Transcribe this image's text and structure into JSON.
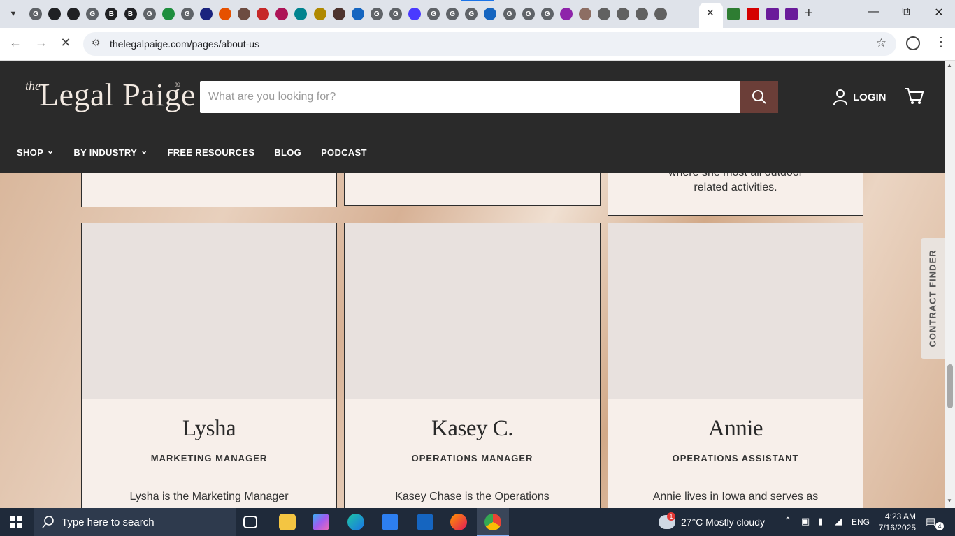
{
  "browser": {
    "url": "thelegalpaige.com/pages/about-us",
    "tab_favicon_letters": [
      "G",
      "",
      "",
      "G",
      "B",
      "B",
      "G",
      "",
      "G",
      "",
      "",
      "",
      "",
      "",
      "",
      "",
      "",
      "",
      "G",
      "G",
      "",
      "G",
      "G",
      "G",
      "",
      "G",
      "G",
      "G",
      "",
      "",
      "",
      "",
      "",
      ""
    ]
  },
  "site": {
    "logo_the": "the",
    "logo_name": "Legal Paige",
    "logo_reg": "®",
    "search_placeholder": "What are you looking for?",
    "login_label": "LOGIN",
    "nav": [
      {
        "label": "SHOP",
        "dropdown": true
      },
      {
        "label": "BY INDUSTRY",
        "dropdown": true
      },
      {
        "label": "FREE RESOURCES",
        "dropdown": false
      },
      {
        "label": "BLOG",
        "dropdown": false
      },
      {
        "label": "PODCAST",
        "dropdown": false
      }
    ],
    "contract_finder_label": "CONTRACT FINDER"
  },
  "prev_row_text": {
    "line1": "where she most all outdoor",
    "line2": "related activities."
  },
  "team": [
    {
      "name": "Lysha",
      "role": "MARKETING MANAGER",
      "bio": "Lysha is the Marketing Manager"
    },
    {
      "name": "Kasey C.",
      "role": "OPERATIONS MANAGER",
      "bio": "Kasey Chase is the Operations"
    },
    {
      "name": "Annie",
      "role": "OPERATIONS ASSISTANT",
      "bio": "Annie lives in Iowa and serves as"
    }
  ],
  "taskbar": {
    "search_placeholder": "Type here to search",
    "weather": "27°C  Mostly cloudy",
    "weather_badge": "1",
    "language": "ENG",
    "time": "4:23 AM",
    "date": "7/16/2025",
    "notification_count": "4"
  }
}
